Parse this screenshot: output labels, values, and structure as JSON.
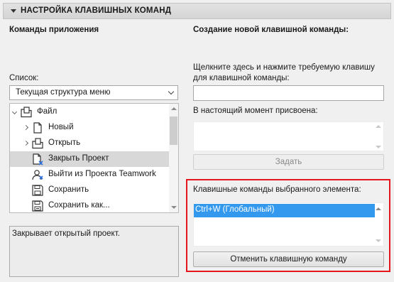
{
  "section": {
    "title": "НАСТРОЙКА КЛАВИШНЫХ КОМАНД"
  },
  "left": {
    "heading": "Команды приложения",
    "list_label": "Список:",
    "list_select_value": "Текущая структура меню",
    "tree": [
      {
        "label": "Файл",
        "icon": "folder-file-icon",
        "expander": "open",
        "indent": 0,
        "selected": false
      },
      {
        "label": "Новый",
        "icon": "new-file-icon",
        "expander": "closed",
        "indent": 1,
        "selected": false
      },
      {
        "label": "Открыть",
        "icon": "open-file-icon",
        "expander": "closed",
        "indent": 1,
        "selected": false
      },
      {
        "label": "Закрыть Проект",
        "icon": "close-project-icon",
        "expander": "none",
        "indent": 1,
        "selected": true
      },
      {
        "label": "Выйти из Проекта Teamwork",
        "icon": "teamwork-user-icon",
        "expander": "none",
        "indent": 1,
        "selected": false
      },
      {
        "label": "Сохранить",
        "icon": "save-icon",
        "expander": "none",
        "indent": 1,
        "selected": false
      },
      {
        "label": "Сохранить как...",
        "icon": "save-as-icon",
        "expander": "none",
        "indent": 1,
        "selected": false
      }
    ],
    "description": "Закрывает открытый проект."
  },
  "right": {
    "heading": "Создание новой клавишной команды:",
    "instruction_line1": "Щелкните здесь и нажмите требуемую клавишу",
    "instruction_line2": "для клавишной команды:",
    "key_input_value": "",
    "assigned_label": "В настоящий момент присвоена:",
    "assign_button": "Задать",
    "element_shortcuts_label": "Клавишные команды выбранного элемента:",
    "element_shortcuts": [
      "Ctrl+W (Глобальный)"
    ],
    "cancel_button": "Отменить клавишную команду"
  },
  "colors": {
    "selection": "#3399ee",
    "highlight_frame": "#e5171d",
    "tree_selected_row": "#d8d8d8"
  }
}
